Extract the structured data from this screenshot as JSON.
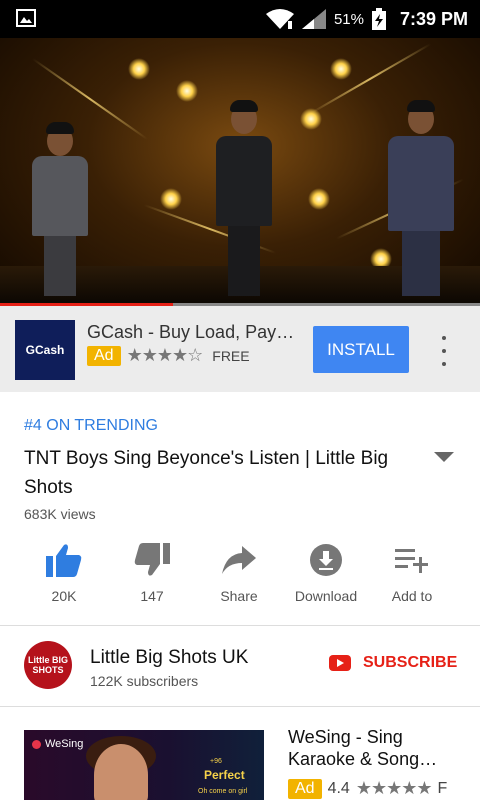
{
  "status_bar": {
    "gallery_icon": "image-icon",
    "battery": "51%",
    "time": "7:39 PM"
  },
  "video": {
    "progress_fraction": 0.36
  },
  "ad_banner": {
    "logo_text": "GCash",
    "title": "GCash - Buy Load, Pay…",
    "badge": "Ad",
    "stars": "★★★★☆",
    "price": "FREE",
    "install_label": "INSTALL"
  },
  "details": {
    "trending": "#4 ON TRENDING",
    "title": "TNT Boys Sing Beyonce's Listen | Little Big Shots",
    "views": "683K views"
  },
  "actions": [
    {
      "label": "20K",
      "icon": "thumbs-up-icon"
    },
    {
      "label": "147",
      "icon": "thumbs-down-icon"
    },
    {
      "label": "Share",
      "icon": "share-icon"
    },
    {
      "label": "Download",
      "icon": "download-icon"
    },
    {
      "label": "Add to",
      "icon": "playlist-add-icon"
    }
  ],
  "channel": {
    "avatar_text": "Little BIG SHOTS",
    "name": "Little Big Shots UK",
    "subscribers": "122K subscribers",
    "subscribe_label": "SUBSCRIBE"
  },
  "ad_card": {
    "thumb_brand": "WeSing",
    "thumb_score": "+96",
    "thumb_text": "Perfect",
    "thumb_sub": "Oh come on girl",
    "title": "WeSing - Sing Karaoke & Song…",
    "badge": "Ad",
    "rating": "4.4",
    "stars": "★★★★★",
    "trailing": "F"
  },
  "colors": {
    "accent_blue": "#3f86f2",
    "youtube_red": "#e62117",
    "ad_yellow": "#f2b300"
  }
}
